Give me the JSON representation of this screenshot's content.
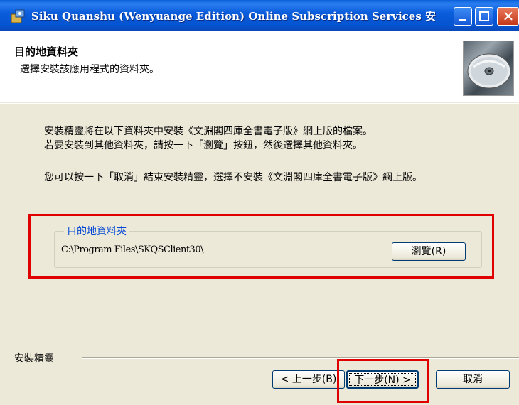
{
  "window": {
    "title": "Siku Quanshu (Wenyuange Edition) Online Subscription Services 安...",
    "close_glyph": "✕"
  },
  "header": {
    "title": "目的地資料夾",
    "subtitle": "選擇安裝該應用程式的資料夾。"
  },
  "body": {
    "line1": "安裝精靈將在以下資料夾中安裝《文淵閣四庫全書電子版》網上版的檔案。",
    "line2": "若要安裝到其他資料夾，請按一下「瀏覽」按鈕，然後選擇其他資料夾。",
    "line3": "您可以按一下「取消」結束安裝精靈，選擇不安裝《文淵閣四庫全書電子版》網上版。"
  },
  "destination": {
    "group_label": "目的地資料夾",
    "path": "C:\\Program Files\\SKQSClient30\\",
    "browse_label": "瀏覽(R)"
  },
  "footer": {
    "wizard_label": "安裝精靈",
    "back_label": "< 上一步(B)",
    "next_label": "下一步(N) >",
    "cancel_label": "取消"
  },
  "colors": {
    "title_bar": "#0554d1",
    "dialog_bg": "#ece9d8",
    "highlight_red": "#e00000",
    "group_label": "#0046d5"
  }
}
